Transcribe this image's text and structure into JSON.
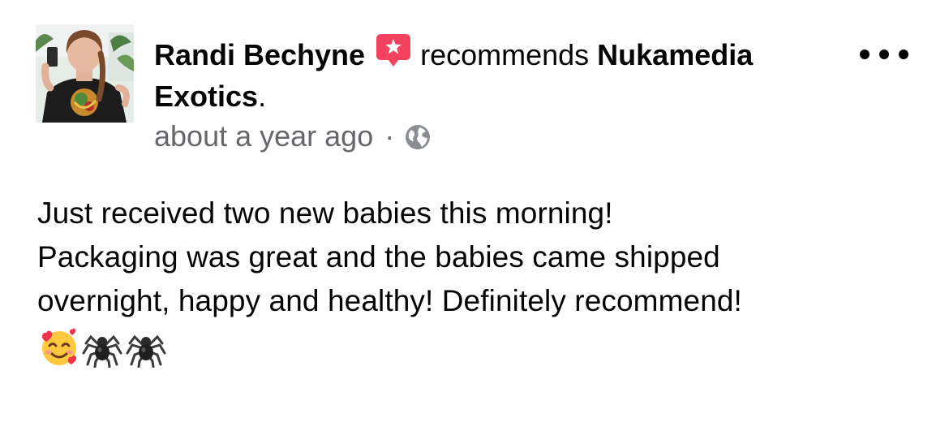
{
  "post": {
    "author": "Randi Bechyne",
    "recommend_word": "recommends",
    "page_name": "Nukamedia Exotics",
    "page_suffix": ".",
    "timestamp": "about a year ago",
    "separator": "·",
    "audience_icon": "globe-icon",
    "badge_icon": "recommendation-star-icon",
    "more_icon": "more-options-icon",
    "body_lines": [
      "Just received two new babies this morning!",
      "Packaging was great and the babies came shipped",
      "overnight, happy and healthy! Definitely recommend!"
    ],
    "emojis": [
      "smiling-face-with-hearts",
      "spider",
      "spider"
    ]
  },
  "colors": {
    "text_primary": "#050505",
    "text_secondary": "#65676b",
    "badge": "#f3425f"
  }
}
